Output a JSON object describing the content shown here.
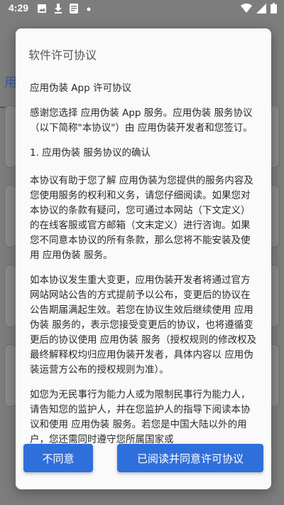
{
  "status_bar": {
    "time": "4:29"
  },
  "background": {
    "tab_partial": "用"
  },
  "dialog": {
    "title": "软件许可协议",
    "paragraphs": [
      "应用伪装 App 许可协议",
      "感谢您选择 应用伪装 App 服务。应用伪装 服务协议（以下简称\"本协议\"）由 应用伪装开发者和您签订。",
      "1. 应用伪装 服务协议的确认",
      "本协议有助于您了解 应用伪装为您提供的服务内容及您使用服务的权利和义务，请您仔细阅读。如果您对本协议的条款有疑问，您可通过本网站（下文定义）的在线客服或官方邮箱（文末定义）进行咨询。如果您不同意本协议的所有条款，那么您将不能安装及使用 应用伪装 服务。",
      "如本协议发生重大变更，应用伪装开发者将通过官方网站网站公告的方式提前予以公布，变更后的协议在公告期届满起生效。若您在协议生效后继续使用 应用伪装 服务的，表示您接受变更后的协议，也将遵循变更后的协议使用 应用伪装 服务（授权规则的修改权及最终解释权均归应用伪装开发者，具体内容以 应用伪装运营方公布的授权规则为准）。",
      "如您为无民事行为能力人或为限制民事行为能力人，请告知您的监护人，并在您监护人的指导下阅读本协议和使用 应用伪装 服务。若您是中国大陆以外的用户，您还需同时遵守您所属国家或"
    ],
    "buttons": {
      "disagree": "不同意",
      "agree": "已阅读并同意许可协议"
    }
  }
}
